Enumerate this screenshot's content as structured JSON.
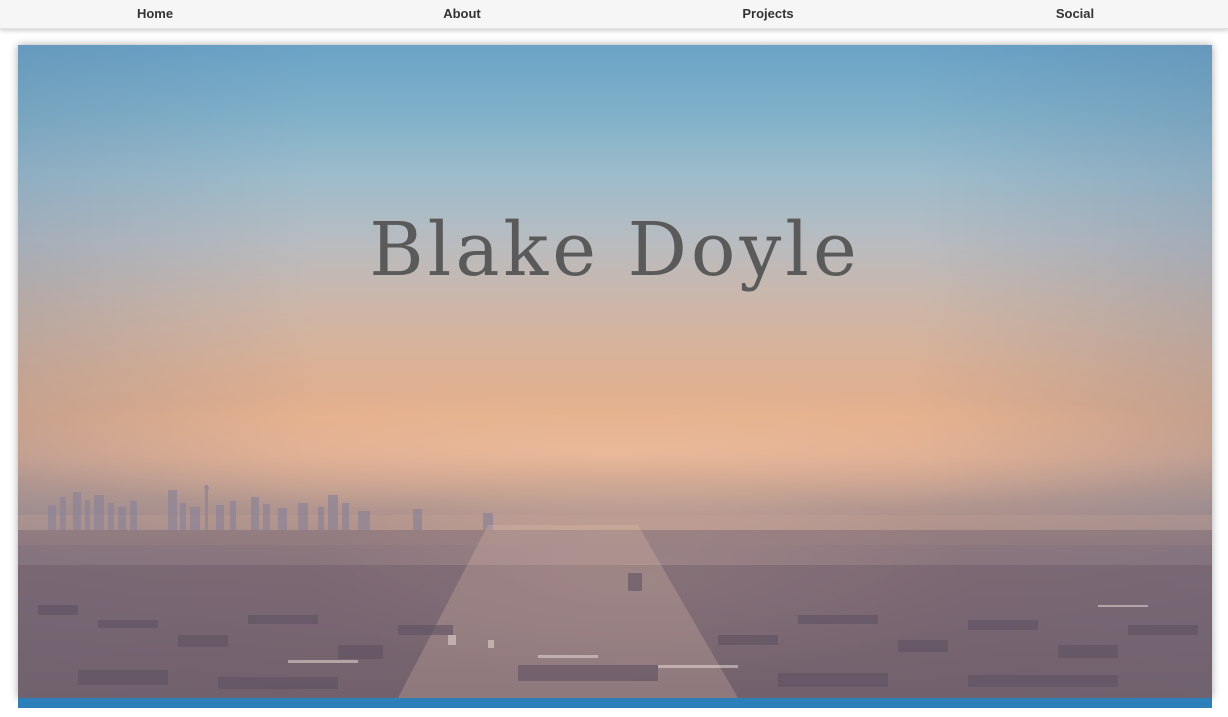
{
  "nav": {
    "items": [
      {
        "label": "Home"
      },
      {
        "label": "About"
      },
      {
        "label": "Projects"
      },
      {
        "label": "Social"
      }
    ]
  },
  "hero": {
    "title": "Blake Doyle",
    "background_image": "hazy-city-skyline-at-sunrise",
    "accent_bar_color": "#2c7fb8"
  }
}
